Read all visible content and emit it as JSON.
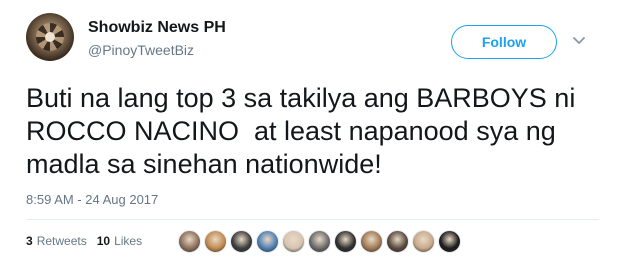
{
  "author": {
    "name": "Showbiz News PH",
    "handle": "@PinoyTweetBiz"
  },
  "follow_button": {
    "label": "Follow"
  },
  "tweet": {
    "text": "Buti na lang top 3 sa takilya ang BARBOYS ni ROCCO NACINO  at least napanood sya ng madla sa sinehan nationwide!",
    "timestamp": "8:59 AM - 24 Aug 2017"
  },
  "stats": {
    "retweets_count": "3",
    "retweets_label": "Retweets",
    "likes_count": "10",
    "likes_label": "Likes"
  },
  "liker_avatar_colors": [
    "#8b6f5a",
    "#c28a4e",
    "#3d3d3d",
    "#4f7fb3",
    "#d7c4b0",
    "#6b6b6b",
    "#2f2f2f",
    "#a07955",
    "#5a4a3e",
    "#c9a98a",
    "#1c1c1c"
  ],
  "colors": {
    "accent": "#1da1f2",
    "text": "#14171a",
    "secondary_text": "#657786"
  }
}
